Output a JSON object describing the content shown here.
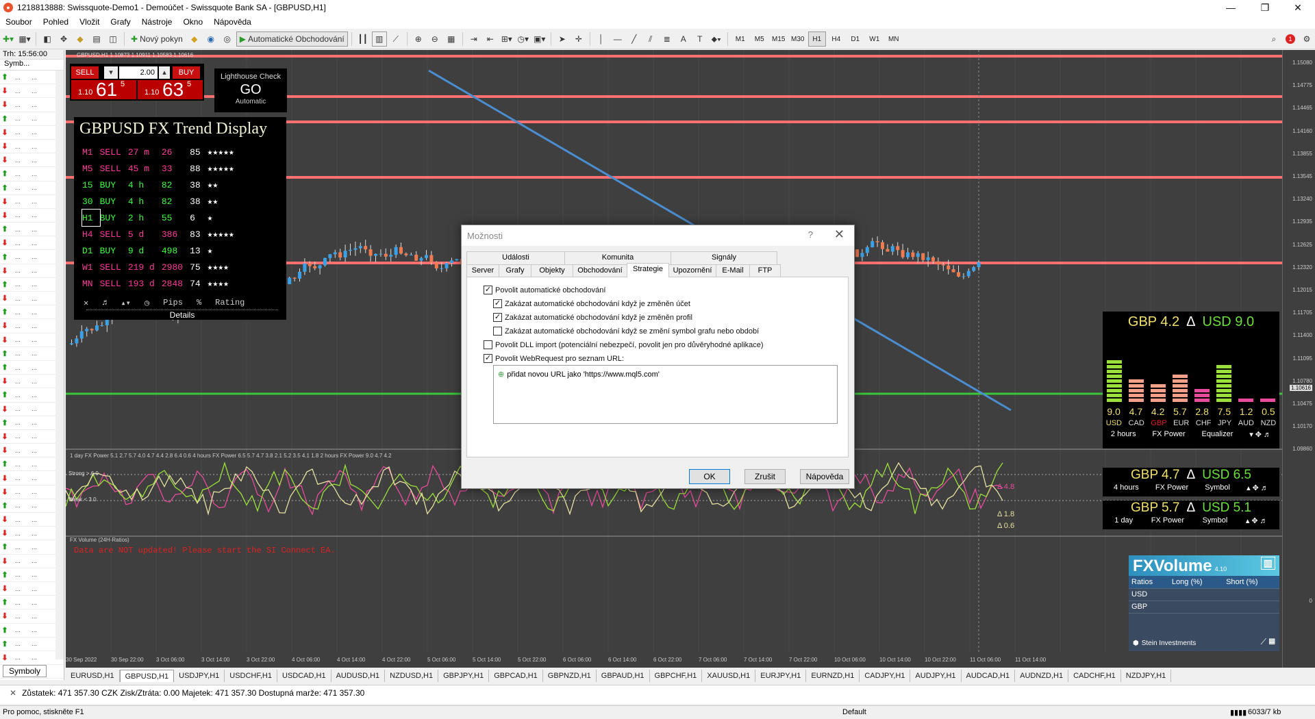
{
  "titlebar": {
    "title": "1218813888: Swissquote-Demo1 - Demoúčet - Swissquote Bank SA - [GBPUSD,H1]",
    "minimize": "—",
    "maximize": "❐",
    "close": "✕"
  },
  "menu": [
    "Soubor",
    "Pohled",
    "Vložit",
    "Grafy",
    "Nástroje",
    "Okno",
    "Nápověda"
  ],
  "toolbar": {
    "new_order": "Nový pokyn",
    "auto_trading": "Automatické Obchodování",
    "timeframes": [
      "M1",
      "M5",
      "M15",
      "M30",
      "H1",
      "H4",
      "D1",
      "W1",
      "MN"
    ],
    "active_timeframe": "H1"
  },
  "market_watch": {
    "time": "Trh: 15:56:00",
    "col_symbol": "Symb...",
    "tab": "Symboly",
    "row_dots": "...",
    "rows": [
      {
        "dir": "up"
      },
      {
        "dir": "down"
      },
      {
        "dir": "down"
      },
      {
        "dir": "up"
      },
      {
        "dir": "down"
      },
      {
        "dir": "down"
      },
      {
        "dir": "down"
      },
      {
        "dir": "up"
      },
      {
        "dir": "up"
      },
      {
        "dir": "down"
      },
      {
        "dir": "down"
      },
      {
        "dir": "up"
      },
      {
        "dir": "down"
      },
      {
        "dir": "up"
      },
      {
        "dir": "down"
      },
      {
        "dir": "up"
      },
      {
        "dir": "down"
      },
      {
        "dir": "up"
      },
      {
        "dir": "down"
      },
      {
        "dir": "down"
      },
      {
        "dir": "up"
      },
      {
        "dir": "up"
      },
      {
        "dir": "down"
      },
      {
        "dir": "up"
      },
      {
        "dir": "down"
      },
      {
        "dir": "up"
      },
      {
        "dir": "down"
      },
      {
        "dir": "down"
      },
      {
        "dir": "up"
      },
      {
        "dir": "down"
      },
      {
        "dir": "down"
      },
      {
        "dir": "up"
      },
      {
        "dir": "down"
      },
      {
        "dir": "down"
      },
      {
        "dir": "up"
      },
      {
        "dir": "down"
      },
      {
        "dir": "up"
      },
      {
        "dir": "down"
      },
      {
        "dir": "up"
      },
      {
        "dir": "down"
      },
      {
        "dir": "up"
      },
      {
        "dir": "up"
      },
      {
        "dir": "down"
      },
      {
        "dir": "down"
      }
    ]
  },
  "chart": {
    "header": "GBPUSD,H1  1.10873 1.10911 1.10583 1.10616",
    "price_labels": [
      "1.15080",
      "1.14775",
      "1.14465",
      "1.14160",
      "1.13855",
      "1.13545",
      "1.13240",
      "1.12935",
      "1.12625",
      "1.12320",
      "1.12015",
      "1.11705",
      "1.11400",
      "1.11095",
      "1.10780",
      "1.10475",
      "1.10170",
      "1.09860",
      "0"
    ],
    "current_price": "1.10616",
    "time_labels": [
      "30 Sep 2022",
      "30 Sep 22:00",
      "3 Oct 06:00",
      "3 Oct 14:00",
      "3 Oct 22:00",
      "4 Oct 06:00",
      "4 Oct 14:00",
      "4 Oct 22:00",
      "5 Oct 06:00",
      "5 Oct 14:00",
      "5 Oct 22:00",
      "6 Oct 06:00",
      "6 Oct 14:00",
      "6 Oct 22:00",
      "7 Oct 06:00",
      "7 Oct 14:00",
      "7 Oct 22:00",
      "10 Oct 06:00",
      "10 Oct 14:00",
      "10 Oct 22:00",
      "11 Oct 06:00",
      "11 Oct 14:00"
    ],
    "fxpower_header": "1 day FX Power 5.1 2.7 5.7 4.0 4.7 4.4 2.8 6.4 0.6   4 hours FX Power 6.5 5.7 4.7 3.8 2.1 5.2 3.5 4.1 1.8   2 hours FX Power 9.0 4.7 4.2",
    "strong": "Strong > 6.0",
    "weak": "Weak < 3.0",
    "delta1": "Δ 4.8",
    "delta2": "Δ 1.8",
    "delta3": "Δ 0.6",
    "fxvol_header": "FX Volume (24H-Ratios)",
    "fxvol_warning": "Data are NOT updated! Please start the SI Connect EA."
  },
  "trade_panel": {
    "sell": "SELL",
    "buy": "BUY",
    "lot": "2.00",
    "sell_prefix": "1.10",
    "sell_big": "61",
    "sell_sup": "5",
    "buy_prefix": "1.10",
    "buy_big": "63",
    "buy_sup": "5"
  },
  "lighthouse": {
    "title": "Lighthouse Check",
    "go": "GO",
    "mode": "Automatic"
  },
  "trend_display": {
    "title": "GBPUSD FX Trend Display",
    "rows": [
      [
        "M1",
        "SELL",
        "27 m",
        "26",
        "85",
        "★★★★★"
      ],
      [
        "M5",
        "SELL",
        "45 m",
        "33",
        "88",
        "★★★★★"
      ],
      [
        "15",
        "BUY",
        "4 h",
        "82",
        "38",
        "★★"
      ],
      [
        "30",
        "BUY",
        "4 h",
        "82",
        "38",
        "★★"
      ],
      [
        "H1",
        "BUY",
        "2 h",
        "55",
        "6",
        "★"
      ],
      [
        "H4",
        "SELL",
        "5 d",
        "386",
        "83",
        "★★★★★"
      ],
      [
        "D1",
        "BUY",
        "9 d",
        "498",
        "13",
        "★"
      ],
      [
        "W1",
        "SELL",
        "219 d",
        "2980",
        "75",
        "★★★★"
      ],
      [
        "MN",
        "SELL",
        "193 d",
        "2848",
        "74",
        "★★★★"
      ]
    ],
    "footer": [
      "✕",
      "♬",
      "▴▾",
      "◷",
      "Pips",
      "%",
      "Rating"
    ],
    "details": "Details"
  },
  "fxpower_eq": {
    "gbp": "GBP 4.2",
    "delta": "Δ",
    "usd": "USD 9.0",
    "values": [
      "9.0",
      "4.7",
      "4.2",
      "5.7",
      "2.8",
      "7.5",
      "1.2",
      "0.5"
    ],
    "currencies": [
      "USD",
      "CAD",
      "GBP",
      "EUR",
      "CHF",
      "JPY",
      "AUD",
      "NZD"
    ],
    "footer": [
      "2 hours",
      "FX Power",
      "Equalizer"
    ]
  },
  "fxpower_4h": {
    "gbp": "GBP 4.7",
    "delta": "Δ",
    "usd": "USD 6.5",
    "footer": [
      "4 hours",
      "FX Power",
      "Symbol"
    ]
  },
  "fxpower_1d": {
    "gbp": "GBP 5.7",
    "delta": "Δ",
    "usd": "USD 5.1",
    "footer": [
      "1 day",
      "FX Power",
      "Symbol"
    ]
  },
  "fxvolume": {
    "title": "FXVolume",
    "version": "4.10",
    "cols": [
      "Ratios",
      "Long (%)",
      "Short (%)"
    ],
    "rows": [
      "USD",
      "GBP"
    ],
    "brand": "Stein Investments"
  },
  "dialog": {
    "title": "Možnosti",
    "help": "?",
    "close": "✕",
    "tabs_top": [
      "Události",
      "Komunita",
      "Signály"
    ],
    "tabs_bottom": [
      "Server",
      "Grafy",
      "Objekty",
      "Obchodování",
      "Strategie",
      "Upozornění",
      "E-Mail",
      "FTP"
    ],
    "active_tab": "Strategie",
    "options": [
      {
        "label": "Povolit automatické obchodování",
        "checked": true,
        "indent": 0
      },
      {
        "label": "Zakázat automatické obchodování když je změněn účet",
        "checked": true,
        "indent": 1
      },
      {
        "label": "Zakázat automatické obchodování když je změněn profil",
        "checked": true,
        "indent": 1
      },
      {
        "label": "Zakázat automatické obchodování když se změní symbol grafu nebo období",
        "checked": false,
        "indent": 1
      },
      {
        "label": "Povolit DLL import (potenciální nebezpečí, povolit jen pro důvěryhodné aplikace)",
        "checked": false,
        "indent": 0
      },
      {
        "label": "Povolit WebRequest pro seznam URL:",
        "checked": true,
        "indent": 0
      }
    ],
    "url_add": "přidat novou URL jako 'https://www.mql5.com'",
    "ok": "OK",
    "cancel": "Zrušit",
    "helpbtn": "Nápověda"
  },
  "chart_tabs": [
    "EURUSD,H1",
    "GBPUSD,H1",
    "USDJPY,H1",
    "USDCHF,H1",
    "USDCAD,H1",
    "AUDUSD,H1",
    "NZDUSD,H1",
    "GBPJPY,H1",
    "GBPCAD,H1",
    "GBPNZD,H1",
    "GBPAUD,H1",
    "GBPCHF,H1",
    "XAUUSD,H1",
    "EURJPY,H1",
    "EURNZD,H1",
    "CADJPY,H1",
    "AUDJPY,H1",
    "AUDCAD,H1",
    "AUDNZD,H1",
    "CADCHF,H1",
    "NZDJPY,H1"
  ],
  "active_chart_tab": "GBPUSD,H1",
  "terminal": "Zůstatek: 471 357.30 CZK  Zisk/Ztráta: 0.00  Majetek: 471 357.30  Dostupná marže: 471 357.30",
  "statusbar": {
    "help": "Pro pomoc, stiskněte F1",
    "profile": "Default",
    "traffic": "6033/7 kb"
  }
}
